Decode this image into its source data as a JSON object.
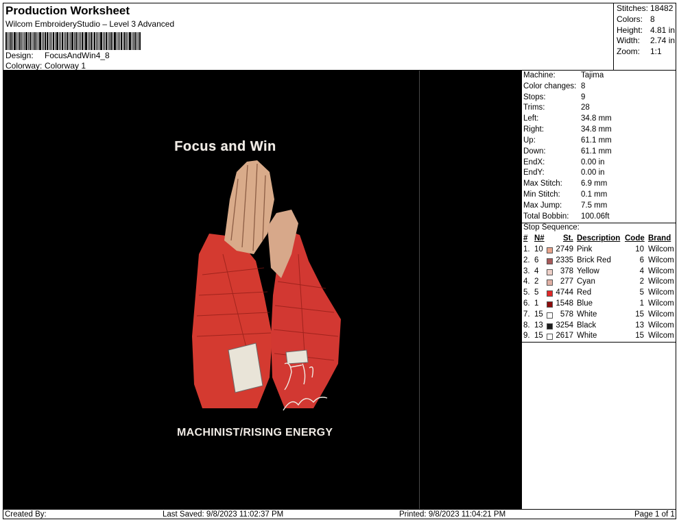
{
  "header": {
    "title": "Production Worksheet",
    "subtitle": "Wilcom EmbroideryStudio – Level 3 Advanced",
    "design_label": "Design:",
    "design_value": "FocusAndWin4_8",
    "colorway_label": "Colorway:",
    "colorway_value": "Colorway 1"
  },
  "stats": [
    {
      "k": "Stitches:",
      "v": "18482"
    },
    {
      "k": "Colors:",
      "v": "8"
    },
    {
      "k": "Height:",
      "v": "4.81 in"
    },
    {
      "k": "Width:",
      "v": "2.74 in"
    },
    {
      "k": "Zoom:",
      "v": "1:1"
    }
  ],
  "design": {
    "text_top": "Focus and Win",
    "text_bottom": "MACHINIST/RISING ENERGY",
    "signature": "Just in Awesome"
  },
  "machine_info": [
    {
      "k": "Machine:",
      "v": "Tajima"
    },
    {
      "k": "Color changes:",
      "v": "8"
    },
    {
      "k": "Stops:",
      "v": "9"
    },
    {
      "k": "Trims:",
      "v": "28"
    },
    {
      "k": "Left:",
      "v": "34.8 mm"
    },
    {
      "k": "Right:",
      "v": "34.8 mm"
    },
    {
      "k": "Up:",
      "v": "61.1 mm"
    },
    {
      "k": "Down:",
      "v": "61.1 mm"
    },
    {
      "k": "EndX:",
      "v": "0.00 in"
    },
    {
      "k": "EndY:",
      "v": "0.00 in"
    },
    {
      "k": "Max Stitch:",
      "v": "6.9 mm"
    },
    {
      "k": "Min Stitch:",
      "v": "0.1 mm"
    },
    {
      "k": "Max Jump:",
      "v": "7.5 mm"
    },
    {
      "k": "Total Bobbin:",
      "v": "100.06ft"
    }
  ],
  "stop_sequence": {
    "label": "Stop Sequence:",
    "columns": [
      "#",
      "N#",
      "St.",
      "Description",
      "Code",
      "Brand"
    ],
    "rows": [
      {
        "idx": "1.",
        "n": "10",
        "st": "2749",
        "desc": "Pink",
        "code": "10",
        "brand": "Wilcom",
        "color": "#e8a48c"
      },
      {
        "idx": "2.",
        "n": "6",
        "st": "2335",
        "desc": "Brick Red",
        "code": "6",
        "brand": "Wilcom",
        "color": "#a85a5a"
      },
      {
        "idx": "3.",
        "n": "4",
        "st": "378",
        "desc": "Yellow",
        "code": "4",
        "brand": "Wilcom",
        "color": "#eed0c8"
      },
      {
        "idx": "4.",
        "n": "2",
        "st": "277",
        "desc": "Cyan",
        "code": "2",
        "brand": "Wilcom",
        "color": "#e0b0a4"
      },
      {
        "idx": "5.",
        "n": "5",
        "st": "4744",
        "desc": "Red",
        "code": "5",
        "brand": "Wilcom",
        "color": "#e02828"
      },
      {
        "idx": "6.",
        "n": "1",
        "st": "1548",
        "desc": "Blue",
        "code": "1",
        "brand": "Wilcom",
        "color": "#8c0c0c"
      },
      {
        "idx": "7.",
        "n": "15",
        "st": "578",
        "desc": "White",
        "code": "15",
        "brand": "Wilcom",
        "color": "#ffffff"
      },
      {
        "idx": "8.",
        "n": "13",
        "st": "3254",
        "desc": "Black",
        "code": "13",
        "brand": "Wilcom",
        "color": "#1c1c1c"
      },
      {
        "idx": "9.",
        "n": "15",
        "st": "2617",
        "desc": "White",
        "code": "15",
        "brand": "Wilcom",
        "color": "#ffffff"
      }
    ]
  },
  "footer": {
    "created_by": "Created By:",
    "last_saved": "Last Saved: 9/8/2023 11:02:37 PM",
    "printed": "Printed: 9/8/2023 11:04:21 PM",
    "page": "Page 1 of 1"
  }
}
